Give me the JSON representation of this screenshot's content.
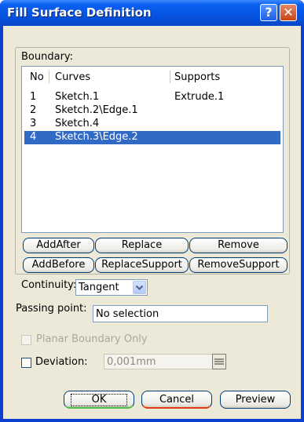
{
  "window": {
    "title": "Fill Surface Definition",
    "help_glyph": "?",
    "close_glyph": "✕"
  },
  "boundary": {
    "label": "Boundary:",
    "columns": [
      "No",
      "Curves",
      "Supports"
    ],
    "rows": [
      {
        "no": "1",
        "curve": "Sketch.1",
        "support": "Extrude.1",
        "selected": false
      },
      {
        "no": "2",
        "curve": "Sketch.2\\Edge.1",
        "support": "",
        "selected": false
      },
      {
        "no": "3",
        "curve": "Sketch.4",
        "support": "",
        "selected": false
      },
      {
        "no": "4",
        "curve": "Sketch.3\\Edge.2",
        "support": "",
        "selected": true
      }
    ],
    "buttons": {
      "add_after": "AddAfter",
      "replace": "Replace",
      "remove": "Remove",
      "add_before": "AddBefore",
      "replace_support": "ReplaceSupport",
      "remove_support": "RemoveSupport"
    }
  },
  "continuity": {
    "label": "Continuity:",
    "value": "Tangent"
  },
  "passing_point": {
    "label": "Passing point:",
    "value": "No selection"
  },
  "planar_boundary": {
    "label": "Planar Boundary Only",
    "checked": false,
    "enabled": false
  },
  "deviation": {
    "label": "Deviation:",
    "value": "0,001mm",
    "checked": false
  },
  "actions": {
    "ok": "OK",
    "cancel": "Cancel",
    "preview": "Preview"
  },
  "colors": {
    "title_bar": "#0554e3",
    "selection": "#316ac5",
    "dialog_bg": "#ece9d8",
    "ok_underline": "#4bbd4b",
    "cancel_underline": "#e33b16"
  }
}
